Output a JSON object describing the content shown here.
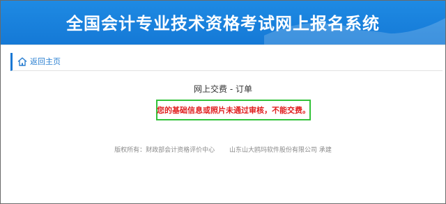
{
  "header": {
    "title": "全国会计专业技术资格考试网上报名系统"
  },
  "nav": {
    "home_label": "返回主页"
  },
  "main": {
    "order_title": "网上交费 - 订单",
    "notice": "您的基础信息或照片未通过审核，不能交费。"
  },
  "footer": {
    "copyright": "版权所有：财政部会计资格评价中心",
    "builder": "山东山大鸥玛软件股份有限公司 承建"
  },
  "colors": {
    "banner": "#1579d6",
    "link": "#2a7fd1",
    "notice_text": "#e01e1e",
    "notice_border": "#32c239"
  },
  "icons": {
    "home": "home-icon"
  }
}
